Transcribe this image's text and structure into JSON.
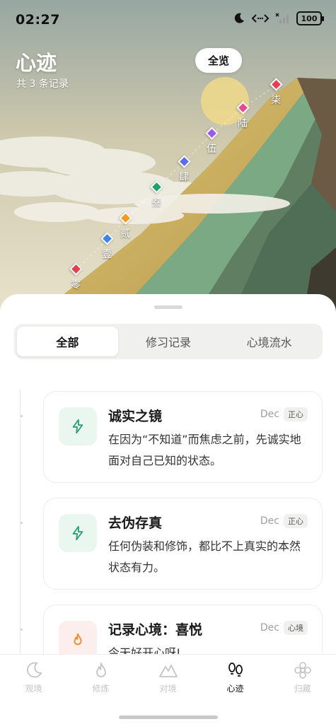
{
  "status": {
    "time": "02:27",
    "battery": "100"
  },
  "hero": {
    "title": "心迹",
    "subtitle": "共 3 条记录",
    "overview_button": "全览",
    "milestones": [
      {
        "label": "零",
        "color": "#e4404f"
      },
      {
        "label": "壹",
        "color": "#3f83e8"
      },
      {
        "label": "贰",
        "color": "#f29a1e"
      },
      {
        "label": "叁",
        "color": "#1fa26b"
      },
      {
        "label": "肆",
        "color": "#5b6cf0"
      },
      {
        "label": "伍",
        "color": "#9b59e8"
      },
      {
        "label": "陆",
        "color": "#e84a8e"
      },
      {
        "label": "柒",
        "color": "#e4404f"
      }
    ]
  },
  "tabs": [
    {
      "label": "全部",
      "active": true
    },
    {
      "label": "修习记录",
      "active": false
    },
    {
      "label": "心境流水",
      "active": false
    }
  ],
  "records": [
    {
      "title": "诚实之镜",
      "date": "Dec",
      "tag": "正心",
      "body": "在因为“不知道”而焦虑之前，先诚实地面对自己已知的状态。",
      "icon": "lightning-icon"
    },
    {
      "title": "去伪存真",
      "date": "Dec",
      "tag": "正心",
      "body": "任何伪装和修饰，都比不上真实的本然状态有力。",
      "icon": "lightning-icon"
    },
    {
      "title": "记录心境：喜悦",
      "date": "Dec",
      "tag": "心境",
      "body": "今天好开心呀!",
      "icon": "flame-icon"
    }
  ],
  "nav": [
    {
      "label": "观境",
      "icon": "moon-icon",
      "active": false
    },
    {
      "label": "修炼",
      "icon": "flame-icon",
      "active": false
    },
    {
      "label": "对境",
      "icon": "mountain-icon",
      "active": false
    },
    {
      "label": "心迹",
      "icon": "footprints-icon",
      "active": true
    },
    {
      "label": "归藏",
      "icon": "flower-icon",
      "active": false
    }
  ],
  "colors": {
    "accent_green": "#2f9e78",
    "icon_bg_green": "#eaf7f1",
    "accent_orange": "#f08a24",
    "icon_bg_orange": "#fdeeee"
  }
}
